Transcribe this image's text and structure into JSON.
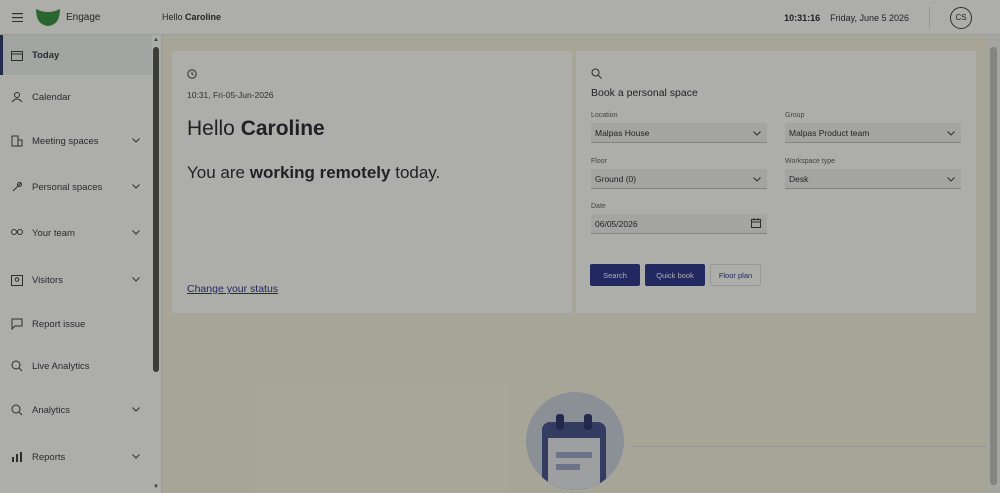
{
  "topbar": {
    "app_name": "Engage",
    "greeting_prefix": "Hello",
    "greeting_name": "Caroline",
    "time": "10:31:16",
    "date": "Friday, June 5 2026",
    "avatar_initials": "CS"
  },
  "sidebar": {
    "items": [
      {
        "label": "Today",
        "icon": "today-icon",
        "active": true,
        "has_chevron": false
      },
      {
        "label": "Calendar",
        "icon": "calendar-icon",
        "active": false,
        "has_chevron": false
      },
      {
        "label": "Meeting spaces",
        "icon": "building-icon",
        "active": false,
        "has_chevron": true
      },
      {
        "label": "Personal spaces",
        "icon": "pin-icon",
        "active": false,
        "has_chevron": true
      },
      {
        "label": "Your team",
        "icon": "team-icon",
        "active": false,
        "has_chevron": true
      },
      {
        "label": "Visitors",
        "icon": "visitor-icon",
        "active": false,
        "has_chevron": true
      },
      {
        "label": "Report issue",
        "icon": "report-icon",
        "active": false,
        "has_chevron": false
      },
      {
        "label": "Live Analytics",
        "icon": "live-analytics-icon",
        "active": false,
        "has_chevron": false
      },
      {
        "label": "Analytics",
        "icon": "analytics-icon",
        "active": false,
        "has_chevron": true
      },
      {
        "label": "Reports",
        "icon": "reports-icon",
        "active": false,
        "has_chevron": true
      }
    ]
  },
  "welcome": {
    "datetime": "10:31, Fri-05-Jun-2026",
    "hello": "Hello",
    "name": "Caroline",
    "status_prefix": "You are",
    "status_bold": "working remotely",
    "status_suffix": "today.",
    "change_status": "Change your status"
  },
  "booking": {
    "title": "Book a personal space",
    "location_label": "Location",
    "location_value": "Malpas House",
    "group_label": "Group",
    "group_value": "Malpas Product team",
    "floor_label": "Floor",
    "floor_value": "Ground (0)",
    "workspace_label": "Workspace type",
    "workspace_value": "Desk",
    "date_label": "Date",
    "date_value": "06/05/2026",
    "search_label": "Search",
    "quickbook_label": "Quick book",
    "floorplan_label": "Floor plan"
  },
  "colors": {
    "primary": "#1f2a8c",
    "background": "#f5f3e3",
    "logo_green": "#2e8b3e"
  }
}
